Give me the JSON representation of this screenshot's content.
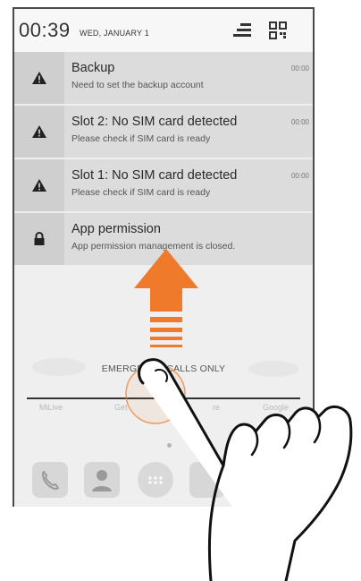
{
  "status_bar": {
    "time": "00:39",
    "date": "WED, JANUARY 1",
    "icons": [
      "quick-settings-icon",
      "notification-grid-icon"
    ]
  },
  "notifications": [
    {
      "icon": "warning-icon",
      "title": "Backup",
      "subtitle": "Need to set the backup account",
      "time": "00:00"
    },
    {
      "icon": "warning-icon",
      "title": "Slot 2: No SIM card detected",
      "subtitle": "Please check if SIM card is ready",
      "time": "00:00"
    },
    {
      "icon": "warning-icon",
      "title": "Slot 1: No SIM card detected",
      "subtitle": "Please check if SIM card is ready",
      "time": "00:00"
    },
    {
      "icon": "lock-icon",
      "title": "App permission",
      "subtitle": "App permission management is closed.",
      "time": ""
    }
  ],
  "lockscreen": {
    "emergency_text": "EMERGENCY CALLS ONLY",
    "apps": [
      "MiLive",
      "Get",
      "re",
      "Google"
    ]
  },
  "dock": {
    "icons": [
      "phone-icon",
      "contacts-icon",
      "app-drawer-icon",
      "camera-icon"
    ]
  },
  "instruction": {
    "arrow_icon": "swipe-up-arrow-icon",
    "gesture_icon": "hand-swipe-icon",
    "arrow_color": "#f07a2b"
  }
}
